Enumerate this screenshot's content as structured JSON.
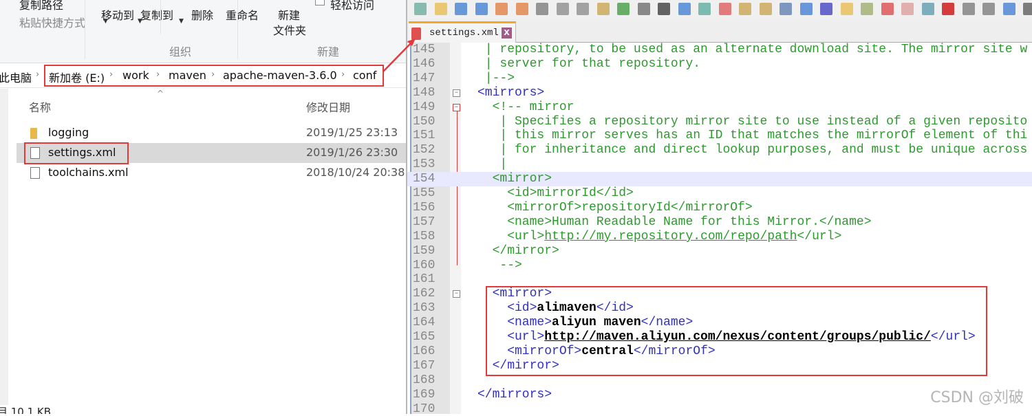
{
  "explorer": {
    "ribbon": {
      "copy_path": "复制路径",
      "paste_shortcut": "粘贴快捷方式",
      "move_to": "移动到",
      "copy_to": "复制到",
      "delete": "删除",
      "rename": "重命名",
      "new_folder_1": "新建",
      "new_folder_2": "文件夹",
      "easy_access": "轻松访问",
      "group_organize": "组织",
      "group_new": "新建"
    },
    "breadcrumb": [
      "此电脑",
      "新加卷 (E:)",
      "work",
      "maven",
      "apache-maven-3.6.0",
      "conf"
    ],
    "columns": {
      "name": "名称",
      "modified": "修改日期"
    },
    "files": [
      {
        "name": "logging",
        "modified": "2019/1/25 23:13",
        "type": "folder"
      },
      {
        "name": "settings.xml",
        "modified": "2019/1/26 23:30",
        "type": "file",
        "selected": true
      },
      {
        "name": "toolchains.xml",
        "modified": "2018/10/24 20:38",
        "type": "file"
      }
    ],
    "status": "目  10.1 KB"
  },
  "editor": {
    "tab_label": "settings.xml",
    "highlight_color": "#e23a3a",
    "lines": [
      {
        "n": "145",
        "parts": [
          [
            "c",
            " | repository, to be used as an alternate download site. The mirror site w"
          ]
        ]
      },
      {
        "n": "146",
        "parts": [
          [
            "c",
            " | server for that repository."
          ]
        ]
      },
      {
        "n": "147",
        "parts": [
          [
            "c",
            " |-->"
          ]
        ]
      },
      {
        "n": "148",
        "parts": [
          [
            "t",
            "<mirrors>"
          ]
        ]
      },
      {
        "n": "149",
        "parts": [
          [
            "c",
            "  <!-- mirror"
          ]
        ]
      },
      {
        "n": "150",
        "parts": [
          [
            "c",
            "   | Specifies a repository mirror site to use instead of a given reposito"
          ]
        ]
      },
      {
        "n": "151",
        "parts": [
          [
            "c",
            "   | this mirror serves has an ID that matches the mirrorOf element of thi"
          ]
        ]
      },
      {
        "n": "152",
        "parts": [
          [
            "c",
            "   | for inheritance and direct lookup purposes, and must be unique across"
          ]
        ]
      },
      {
        "n": "153",
        "parts": [
          [
            "c",
            "   |"
          ]
        ]
      },
      {
        "n": "154",
        "parts": [
          [
            "c",
            "  <mirror>"
          ]
        ],
        "hl": true
      },
      {
        "n": "155",
        "parts": [
          [
            "c",
            "    <id>mirrorId</id>"
          ]
        ]
      },
      {
        "n": "156",
        "parts": [
          [
            "c",
            "    <mirrorOf>repositoryId</mirrorOf>"
          ]
        ]
      },
      {
        "n": "157",
        "parts": [
          [
            "c",
            "    <name>Human Readable Name for this Mirror.</name>"
          ]
        ]
      },
      {
        "n": "158",
        "parts": [
          [
            "c",
            "    <url>"
          ],
          [
            "u",
            "http://my.repository.com/repo/path"
          ],
          [
            "c",
            "</url>"
          ]
        ]
      },
      {
        "n": "159",
        "parts": [
          [
            "c",
            "  </mirror>"
          ]
        ]
      },
      {
        "n": "160",
        "parts": [
          [
            "c",
            "   -->"
          ]
        ]
      },
      {
        "n": "161",
        "parts": []
      },
      {
        "n": "162",
        "parts": [
          [
            "t",
            "  <mirror>"
          ]
        ]
      },
      {
        "n": "163",
        "parts": [
          [
            "t",
            "    <id>"
          ],
          [
            "b",
            "alimaven"
          ],
          [
            "t",
            "</id>"
          ]
        ]
      },
      {
        "n": "164",
        "parts": [
          [
            "t",
            "    <name>"
          ],
          [
            "b",
            "aliyun maven"
          ],
          [
            "t",
            "</name>"
          ]
        ]
      },
      {
        "n": "165",
        "parts": [
          [
            "t",
            "    <url>"
          ],
          [
            "ub",
            "http://maven.aliyun.com/nexus/content/groups/public/"
          ],
          [
            "t",
            "</url>"
          ]
        ]
      },
      {
        "n": "166",
        "parts": [
          [
            "t",
            "    <mirrorOf>"
          ],
          [
            "b",
            "central"
          ],
          [
            "t",
            "</mirrorOf>"
          ]
        ]
      },
      {
        "n": "167",
        "parts": [
          [
            "t",
            "  </mirror>"
          ]
        ]
      },
      {
        "n": "168",
        "parts": []
      },
      {
        "n": "169",
        "parts": [
          [
            "t",
            "</mirrors>"
          ]
        ]
      },
      {
        "n": "170",
        "parts": []
      }
    ]
  },
  "watermark": "CSDN @刘破"
}
